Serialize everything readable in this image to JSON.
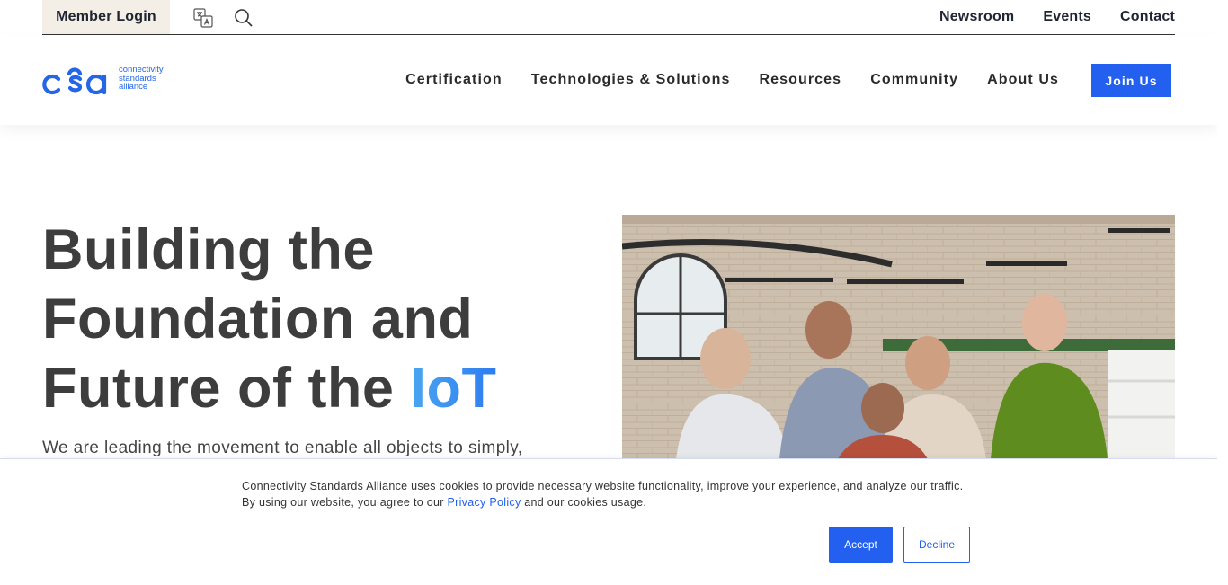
{
  "topbar": {
    "member_login": "Member Login",
    "icons": [
      "translate-icon",
      "search-icon"
    ],
    "links": [
      "Newsroom",
      "Events",
      "Contact"
    ]
  },
  "brand": {
    "logo_mark": "csa",
    "logo_text": [
      "connectivity",
      "standards",
      "alliance"
    ],
    "color": "#2466e6"
  },
  "nav": {
    "items": [
      "Certification",
      "Technologies & Solutions",
      "Resources",
      "Community",
      "About Us"
    ],
    "join_label": "Join Us",
    "accent": "#2360f0"
  },
  "hero": {
    "title_line1": "Building the",
    "title_line2": "Foundation and",
    "title_line3_prefix": "Future of the ",
    "title_accent": "IoT",
    "subtitle": "We are leading the movement to enable all objects to simply,"
  },
  "cookie": {
    "line1": "Connectivity Standards Alliance uses cookies to provide necessary website functionality, improve your experience, and analyze our traffic.",
    "line2_prefix": "By using our website, you agree to our ",
    "privacy_link": "Privacy Policy",
    "line2_suffix": " and our cookies usage.",
    "accept_label": "Accept",
    "decline_label": "Decline"
  }
}
